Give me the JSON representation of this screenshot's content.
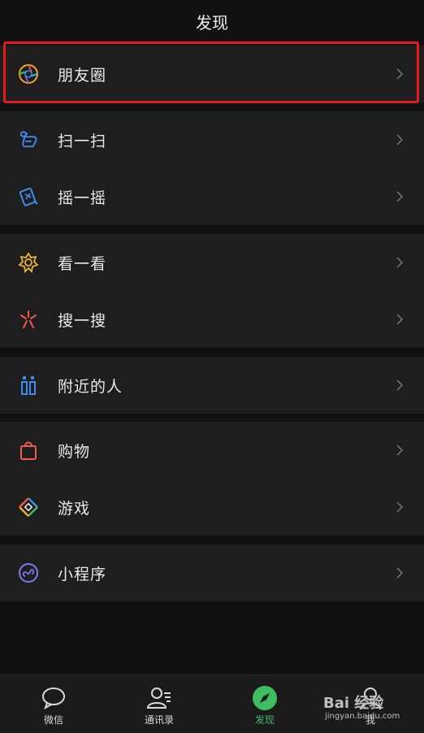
{
  "header": {
    "title": "发现"
  },
  "groups": [
    {
      "items": [
        {
          "label": "朋友圈",
          "icon": "moments-icon",
          "highlighted": true
        }
      ]
    },
    {
      "items": [
        {
          "label": "扫一扫",
          "icon": "scan-icon"
        },
        {
          "label": "摇一摇",
          "icon": "shake-icon"
        }
      ]
    },
    {
      "items": [
        {
          "label": "看一看",
          "icon": "top-stories-icon"
        },
        {
          "label": "搜一搜",
          "icon": "search-icon"
        }
      ]
    },
    {
      "items": [
        {
          "label": "附近的人",
          "icon": "people-nearby-icon"
        }
      ]
    },
    {
      "items": [
        {
          "label": "购物",
          "icon": "shopping-bag-icon"
        },
        {
          "label": "游戏",
          "icon": "games-icon"
        }
      ]
    },
    {
      "items": [
        {
          "label": "小程序",
          "icon": "mini-programs-icon"
        }
      ]
    }
  ],
  "tabbar": {
    "tabs": [
      {
        "label": "微信",
        "icon": "chat-icon",
        "active": false
      },
      {
        "label": "通讯录",
        "icon": "contacts-icon",
        "active": false
      },
      {
        "label": "发现",
        "icon": "compass-icon",
        "active": true
      },
      {
        "label": "我",
        "icon": "me-icon",
        "active": false
      }
    ]
  },
  "colors": {
    "background": "#111111",
    "cell": "#1e1e1e",
    "active_green": "#3fbd63",
    "highlight_red": "#e5191f"
  },
  "watermark": {
    "logo": "Bai 经验",
    "sub": "jingyan.baidu.com"
  }
}
